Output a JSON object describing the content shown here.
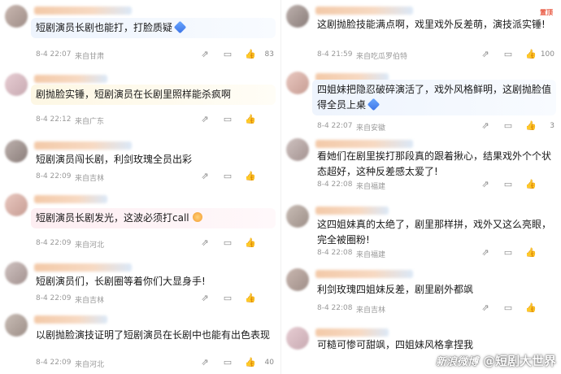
{
  "left": [
    {
      "text": "短剧演员长剧也能打，打脸质疑",
      "time": "8-4 22:07",
      "loc": "来自甘肃",
      "likes": "83",
      "tint": "blue",
      "emoji": "diamond"
    },
    {
      "text": "剧抛脸实锤，短剧演员在长剧里照样能杀疯啊",
      "time": "8-4 22:12",
      "loc": "来自广东",
      "likes": "",
      "tint": "yellow",
      "emoji": ""
    },
    {
      "text": "短剧演员闯长剧，利剑玫瑰全员出彩",
      "time": "8-4 22:09",
      "loc": "来自吉林",
      "likes": "",
      "tint": "none",
      "emoji": ""
    },
    {
      "text": "短剧演员长剧发光，这波必须打call",
      "time": "8-4 22:09",
      "loc": "来自河北",
      "likes": "",
      "tint": "pink",
      "emoji": "sparkle"
    },
    {
      "text": "短剧演员们，长剧圈等着你们大显身手!",
      "time": "8-4 22:09",
      "loc": "来自吉林",
      "likes": "",
      "tint": "none",
      "emoji": ""
    },
    {
      "text": "以剧抛脸演技证明了短剧演员在长剧中也能有出色表现",
      "time": "8-4 22:09",
      "loc": "来自河北",
      "likes": "40",
      "tint": "none",
      "emoji": ""
    }
  ],
  "right": [
    {
      "text": "这剧抛脸技能满点啊，戏里戏外反差萌，演技派实锤!",
      "time": "8-4 21:59",
      "loc": "来自吃瓜罗伯特",
      "likes": "100",
      "tint": "none",
      "emoji": "",
      "badge": "置顶"
    },
    {
      "text": "四姐妹把隐忍破碎演活了，戏外风格鲜明，这剧抛脸值得全员上桌",
      "time": "8-4 22:07",
      "loc": "来自安徽",
      "likes": "3",
      "tint": "blue",
      "emoji": "diamond"
    },
    {
      "text": "看她们在剧里挨打那段真的跟着揪心，结果戏外个个状态超好，这种反差感太爱了!",
      "time": "8-4 22:08",
      "loc": "来自福建",
      "likes": "",
      "tint": "none",
      "emoji": ""
    },
    {
      "text": "这四姐妹真的太绝了，剧里那样拼，戏外又这么亮眼，完全被圈粉!",
      "time": "8-4 22:08",
      "loc": "来自福建",
      "likes": "",
      "tint": "none",
      "emoji": ""
    },
    {
      "text": "利剑玫瑰四姐妹反差，剧里剧外都飒",
      "time": "8-4 22:08",
      "loc": "来自吉林",
      "likes": "",
      "tint": "none",
      "emoji": ""
    },
    {
      "text": "可糙可惨可甜飒，四姐妹风格拿捏我",
      "time": "",
      "loc": "",
      "likes": "",
      "tint": "none",
      "emoji": ""
    }
  ],
  "watermark": {
    "logo": "新浪微博",
    "handle": "@短剧大世界"
  }
}
